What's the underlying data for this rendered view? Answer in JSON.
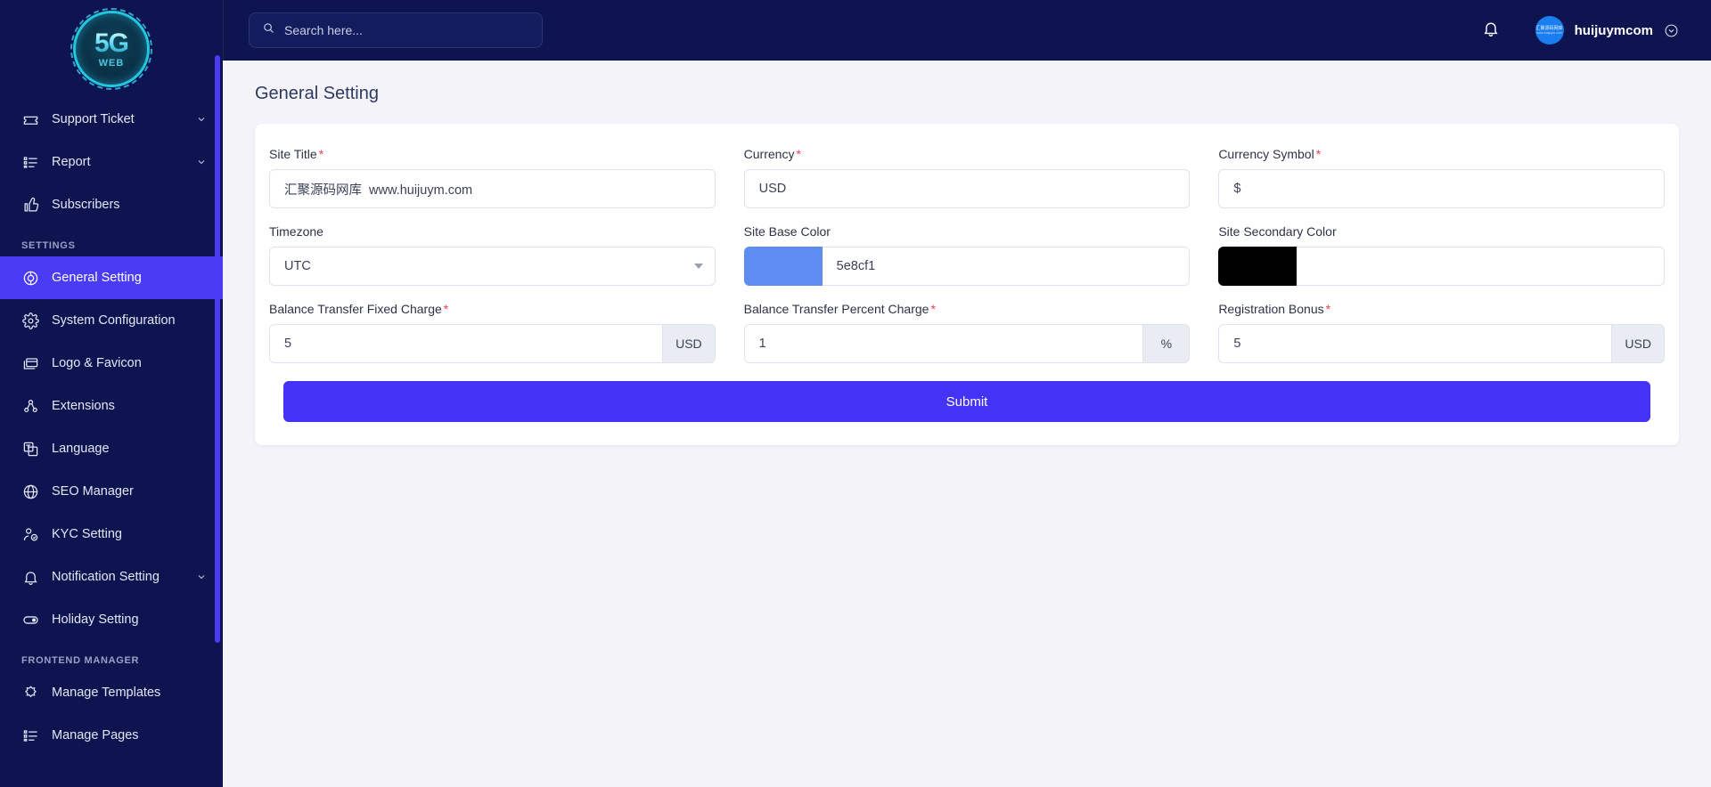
{
  "sidebar": {
    "logo": {
      "primary": "5G",
      "secondary": "WEB"
    },
    "top_items": [
      {
        "label": "Support Ticket",
        "icon": "ticket-icon",
        "caret": true
      },
      {
        "label": "Report",
        "icon": "list-report-icon",
        "caret": true
      },
      {
        "label": "Subscribers",
        "icon": "thumbs-up-icon",
        "caret": false
      }
    ],
    "settings_header": "SETTINGS",
    "settings_items": [
      {
        "label": "General Setting",
        "icon": "globe-ring-icon",
        "caret": false,
        "active": true
      },
      {
        "label": "System Configuration",
        "icon": "gear-icon",
        "caret": false,
        "active": false
      },
      {
        "label": "Logo & Favicon",
        "icon": "window-icon",
        "caret": false,
        "active": false
      },
      {
        "label": "Extensions",
        "icon": "nodes-icon",
        "caret": false,
        "active": false
      },
      {
        "label": "Language",
        "icon": "translate-icon",
        "caret": false,
        "active": false
      },
      {
        "label": "SEO Manager",
        "icon": "globe-icon",
        "caret": false,
        "active": false
      },
      {
        "label": "KYC Setting",
        "icon": "user-check-icon",
        "caret": false,
        "active": false
      },
      {
        "label": "Notification Setting",
        "icon": "bell-icon",
        "caret": true,
        "active": false
      },
      {
        "label": "Holiday Setting",
        "icon": "toggle-icon",
        "caret": false,
        "active": false
      }
    ],
    "frontend_header": "FRONTEND MANAGER",
    "frontend_items": [
      {
        "label": "Manage Templates",
        "icon": "puzzle-icon",
        "caret": false
      },
      {
        "label": "Manage Pages",
        "icon": "list-pages-icon",
        "caret": false
      }
    ]
  },
  "topbar": {
    "search_placeholder": "Search here...",
    "username": "huijuymcom",
    "avatar_line1": "汇聚源码网库",
    "avatar_line2": "www.huijuym.com"
  },
  "page": {
    "title": "General Setting"
  },
  "form": {
    "site_title": {
      "label": "Site Title",
      "required": true,
      "value": "汇聚源码网库  www.huijuym.com"
    },
    "currency": {
      "label": "Currency",
      "required": true,
      "value": "USD"
    },
    "currency_symbol": {
      "label": "Currency Symbol",
      "required": true,
      "value": "$"
    },
    "timezone": {
      "label": "Timezone",
      "required": false,
      "value": "UTC"
    },
    "site_base_color": {
      "label": "Site Base Color",
      "required": false,
      "value": "5e8cf1",
      "swatch": "#5e8cf1"
    },
    "site_secondary_color": {
      "label": "Site Secondary Color",
      "required": false,
      "value": "",
      "swatch": "#000000"
    },
    "balance_transfer_fixed_charge": {
      "label": "Balance Transfer Fixed Charge",
      "required": true,
      "value": "5",
      "addon": "USD"
    },
    "balance_transfer_percent_charge": {
      "label": "Balance Transfer Percent Charge",
      "required": true,
      "value": "1",
      "addon": "%"
    },
    "registration_bonus": {
      "label": "Registration Bonus",
      "required": true,
      "value": "5",
      "addon": "USD"
    },
    "submit_label": "Submit"
  },
  "colors": {
    "sidebar_bg": "#0d1450",
    "accent": "#4a3bf5",
    "submit": "#4433f5",
    "page_bg": "#f4f3f9",
    "required": "#ef4056"
  }
}
